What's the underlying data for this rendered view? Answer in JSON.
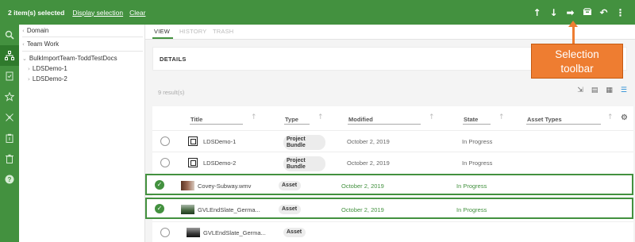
{
  "topbar": {
    "selected_text": "2 item(s) selected",
    "display_selection": "Display selection",
    "clear": "Clear",
    "icons": [
      {
        "name": "move-up-icon",
        "glyph": "↑"
      },
      {
        "name": "move-down-icon",
        "glyph": "↓"
      },
      {
        "name": "forward-icon",
        "glyph": "➡"
      },
      {
        "name": "inbox-icon",
        "glyph": "▬"
      },
      {
        "name": "undo-icon",
        "glyph": "↶"
      },
      {
        "name": "more-icon",
        "glyph": "⋮"
      }
    ]
  },
  "rail": [
    "search-icon",
    "sitemap-icon",
    "task-icon",
    "star-icon",
    "network-icon",
    "clipboard-icon",
    "trash-icon",
    "help-icon"
  ],
  "tree": {
    "domain": "Domain",
    "team_work": "Team Work",
    "root": "BulkImportTeam-ToddTestDocs",
    "children": [
      "LDSDemo-1",
      "LDSDemo-2"
    ]
  },
  "tabs": [
    "VIEW",
    "HISTORY",
    "TRASH"
  ],
  "details_label": "DETAILS",
  "results": "9 result(s)",
  "columns": {
    "title": "Title",
    "type": "Type",
    "modified": "Modified",
    "state": "State",
    "asset_types": "Asset Types"
  },
  "rows": [
    {
      "title": "LDSDemo-1",
      "type_line1": "Project",
      "type_line2": "Bundle",
      "modified": "October 2, 2019",
      "state": "In Progress"
    },
    {
      "title": "LDSDemo-2",
      "type_line1": "Project",
      "type_line2": "Bundle",
      "modified": "October 2, 2019",
      "state": "In Progress"
    },
    {
      "title": "Covey-Subway.wmv",
      "type_line1": "Asset",
      "type_line2": "",
      "modified": "October 2, 2019",
      "state": "In Progress"
    },
    {
      "title": "GVLEndSlate_Germa...",
      "type_line1": "Asset",
      "type_line2": "",
      "modified": "October 2, 2019",
      "state": "In Progress"
    },
    {
      "title": "GVLEndSlate_Germa...",
      "type_line1": "Asset",
      "type_line2": "",
      "modified": "",
      "state": ""
    }
  ],
  "callout": {
    "line1": "Selection",
    "line2": "toolbar"
  },
  "colors": {
    "brand_green": "#43913f",
    "callout_orange": "#ee7d31"
  }
}
